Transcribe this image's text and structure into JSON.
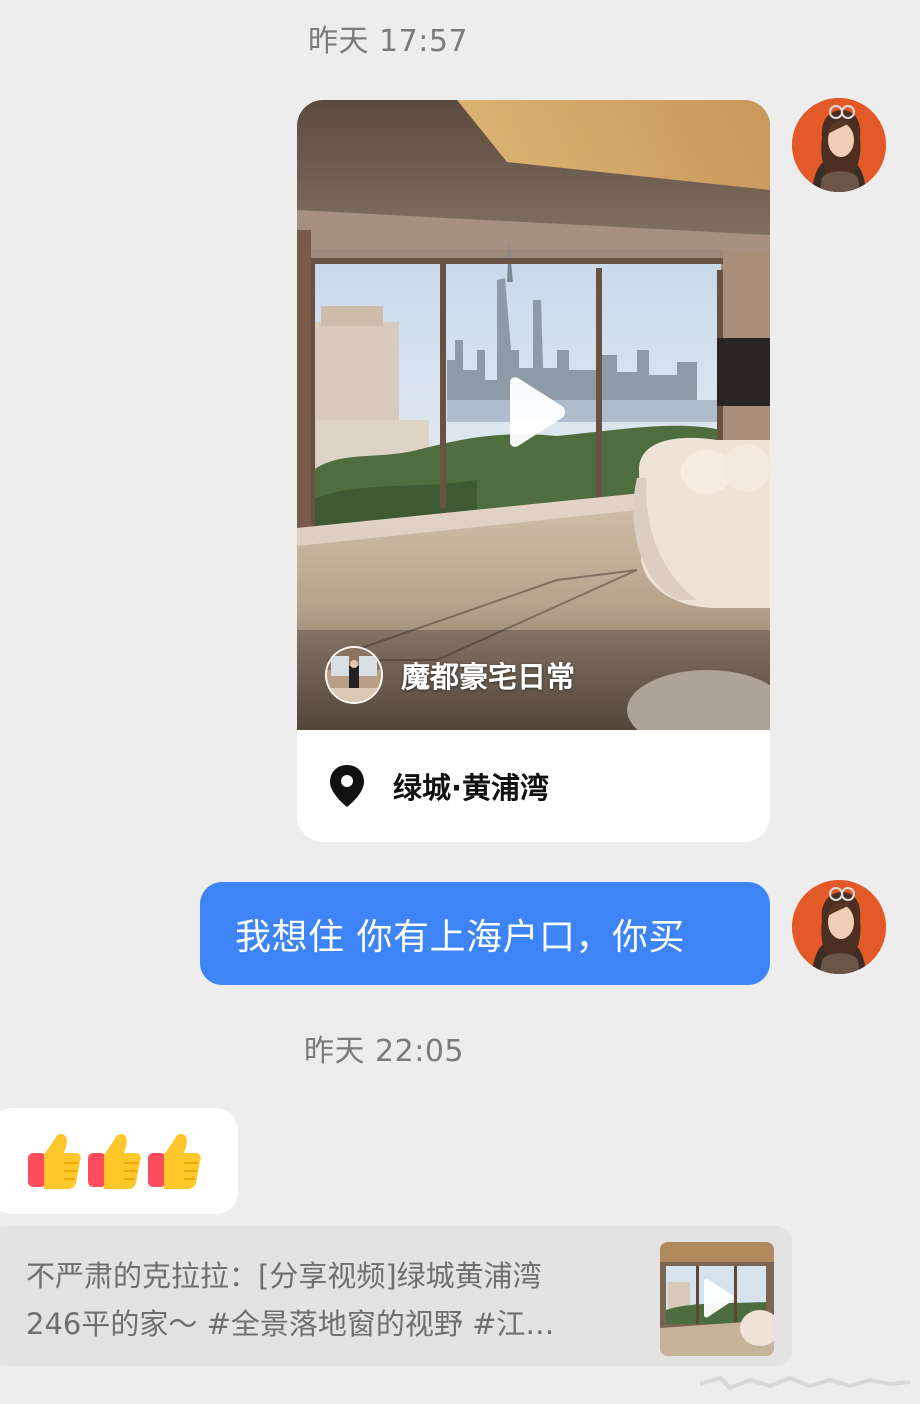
{
  "chat": {
    "timestamp_1": "昨天 17:57",
    "timestamp_2": "昨天 22:05",
    "video_card": {
      "author": "魔都豪宅日常",
      "location": "绿城·黄浦湾",
      "icons": [
        "play-icon",
        "location-pin-icon"
      ]
    },
    "sent_message": "我想住 你有上海户口，你买",
    "received_emojis": [
      "👍",
      "👍",
      "👍"
    ],
    "quote": {
      "line_1": "不严肃的克拉拉：[分享视频]绿城黄浦湾",
      "line_2": "246平的家～ #全景落地窗的视野 #江…"
    }
  },
  "colors": {
    "background": "#ededed",
    "sent_bubble": "#3d84f7",
    "timestamp_text": "#7b7b7b"
  }
}
